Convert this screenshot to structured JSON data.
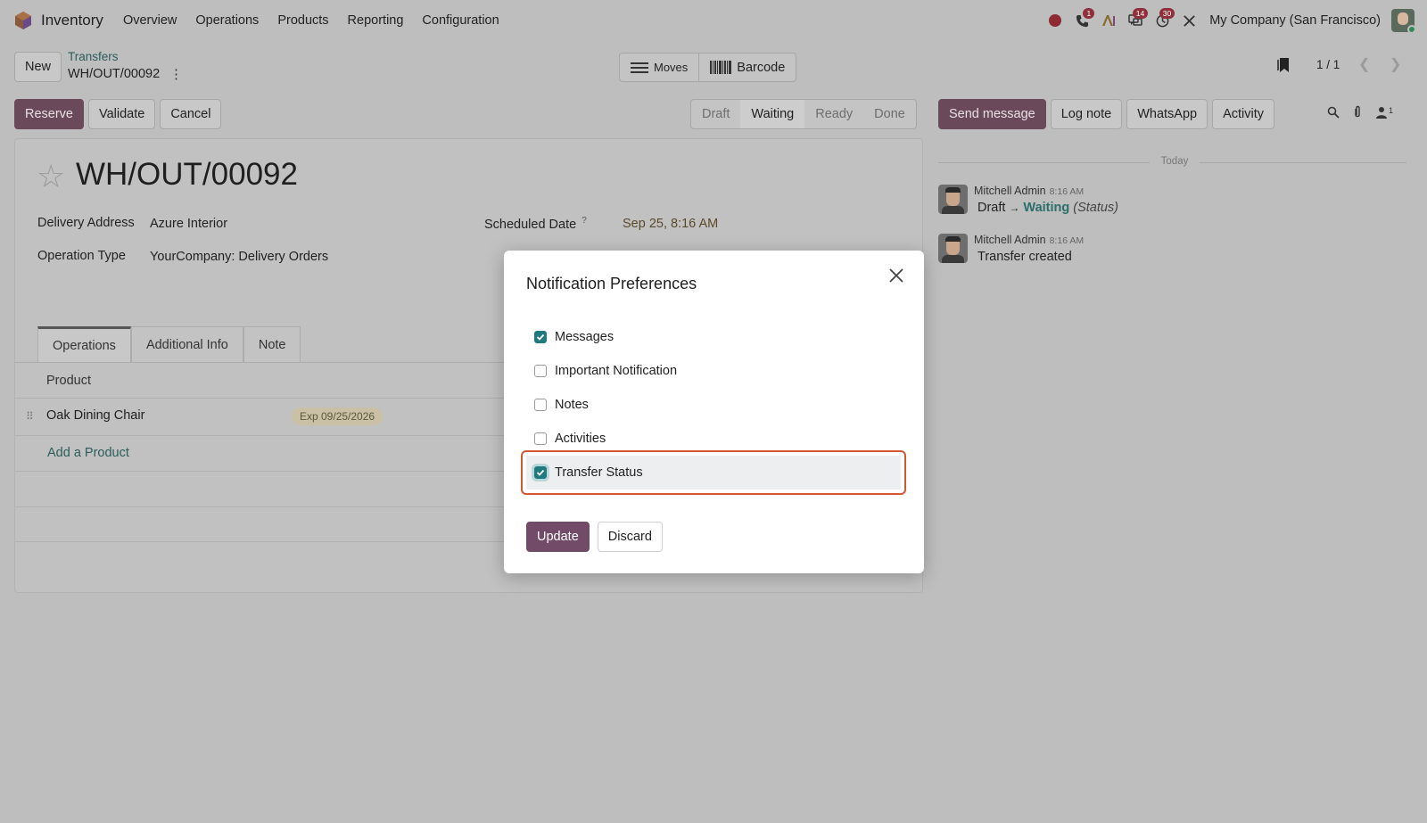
{
  "app": {
    "name": "Inventory",
    "menus": [
      "Overview",
      "Operations",
      "Products",
      "Reporting",
      "Configuration"
    ],
    "company": "My Company (San Francisco)",
    "badges": {
      "phone": "1",
      "messages": "14",
      "activities": "30"
    }
  },
  "control": {
    "new_label": "New",
    "breadcrumb": "Transfers",
    "record": "WH/OUT/00092",
    "view_moves": "Moves",
    "view_barcode": "Barcode",
    "pager": "1 / 1"
  },
  "actions": {
    "reserve": "Reserve",
    "validate": "Validate",
    "cancel": "Cancel"
  },
  "statusbar": {
    "stages": [
      "Draft",
      "Waiting",
      "Ready",
      "Done"
    ],
    "active": "Waiting"
  },
  "chatter_actions": {
    "send_message": "Send message",
    "log_note": "Log note",
    "whatsapp": "WhatsApp",
    "activity": "Activity",
    "followers": "1"
  },
  "form": {
    "title": "WH/OUT/00092",
    "delivery_address_label": "Delivery Address",
    "delivery_address": "Azure Interior",
    "operation_type_label": "Operation Type",
    "operation_type": "YourCompany: Delivery Orders",
    "scheduled_date_label": "Scheduled Date",
    "scheduled_date": "Sep 25, 8:16 AM",
    "help_mark": "?",
    "tabs": [
      "Operations",
      "Additional Info",
      "Note"
    ],
    "column_product": "Product",
    "row_product": "Oak Dining Chair",
    "row_expiry": "Exp 09/25/2026",
    "add_product": "Add a Product"
  },
  "chatter": {
    "separator": "Today",
    "messages": [
      {
        "author": "Mitchell Admin",
        "time": "8:16 AM",
        "from": "Draft",
        "to": "Waiting",
        "field": "(Status)"
      },
      {
        "author": "Mitchell Admin",
        "time": "8:16 AM",
        "body": "Transfer created"
      }
    ]
  },
  "modal": {
    "title": "Notification Preferences",
    "options": [
      {
        "label": "Messages",
        "checked": true
      },
      {
        "label": "Important Notification",
        "checked": false
      },
      {
        "label": "Notes",
        "checked": false
      },
      {
        "label": "Activities",
        "checked": false
      },
      {
        "label": "Transfer Status",
        "checked": true
      }
    ],
    "update": "Update",
    "discard": "Discard"
  },
  "colors": {
    "primary": "#714b67",
    "check": "#1f7a80",
    "highlight": "#d2582f",
    "badge": "#8f2f3a",
    "link": "#2b5d5a"
  }
}
